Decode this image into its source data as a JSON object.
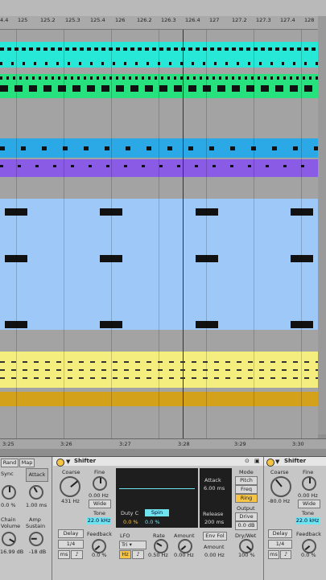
{
  "ruler": {
    "labels": [
      "4.4",
      "125",
      "125.2",
      "125.3",
      "125.4",
      "126",
      "126.2",
      "126.3",
      "126.4",
      "127",
      "127.2",
      "127.3",
      "127.4",
      "128"
    ]
  },
  "bottom_ruler": {
    "labels": [
      "3:25",
      "3:26",
      "3:27",
      "3:28",
      "3:29",
      "3:30"
    ]
  },
  "colors": {
    "cyan": "#27e8d7",
    "green": "#27e07e",
    "blue": "#2aa9e6",
    "purple": "#8a5ce6",
    "lightblue": "#9ec8f7",
    "yellow": "#f3ee7e",
    "gold": "#d4a21a"
  },
  "left_strip": {
    "rand": "Rand",
    "map": "Map",
    "sync": "Sync",
    "attack": "Attack",
    "pct": "0.0 %",
    "ms": "1.00 ms",
    "chain": "Chain",
    "volume": "Volume",
    "amp": "Amp",
    "sustain": "Sustain",
    "db1": "16.99 dB",
    "db2": "-18 dB"
  },
  "shifter1": {
    "title": "Shifter",
    "coarse_label": "Coarse",
    "coarse_val": "431 Hz",
    "fine_label": "Fine",
    "fine_val": "0.00 Hz",
    "wide": "Wide",
    "tone_label": "Tone",
    "tone_val": "22.0 kHz",
    "delay": "Delay",
    "delay_val": "1/4",
    "ms": "ms",
    "feedback": "Feedback",
    "feedback_val": "0.0 %",
    "duty": "Duty C",
    "spin": "Spin",
    "duty_val": "0.0 %",
    "spin_val": "0.0 %",
    "attack": "Attack",
    "attack_val": "6.00 ms",
    "release": "Release",
    "release_val": "200 ms",
    "mode": "Mode",
    "pitch": "Pitch",
    "freq": "Freq",
    "ring": "Ring",
    "output": "Output",
    "drive": "Drive",
    "out_db": "0.0 dB",
    "lfo": "LFO",
    "tri": "Tri",
    "hz": "Hz",
    "rate": "Rate",
    "rate_val": "0.50 Hz",
    "amount": "Amount",
    "amount_val": "0.00 Hz",
    "envfol": "Env Fol",
    "env_amount": "Amount",
    "env_amount_val": "0.00 Hz",
    "drywet": "Dry/Wet",
    "drywet_val": "100 %"
  },
  "shifter2": {
    "title": "Shifter",
    "coarse_label": "Coarse",
    "coarse_val": "-80.0 Hz",
    "fine_label": "Fine",
    "fine_val": "0.00 Hz",
    "wide": "Wide",
    "tone_label": "Tone",
    "tone_val": "22.0 kHz",
    "delay": "Delay",
    "delay_val": "1/4",
    "ms": "ms",
    "feedback": "Feedback",
    "feedback_val": "0.0 %"
  }
}
